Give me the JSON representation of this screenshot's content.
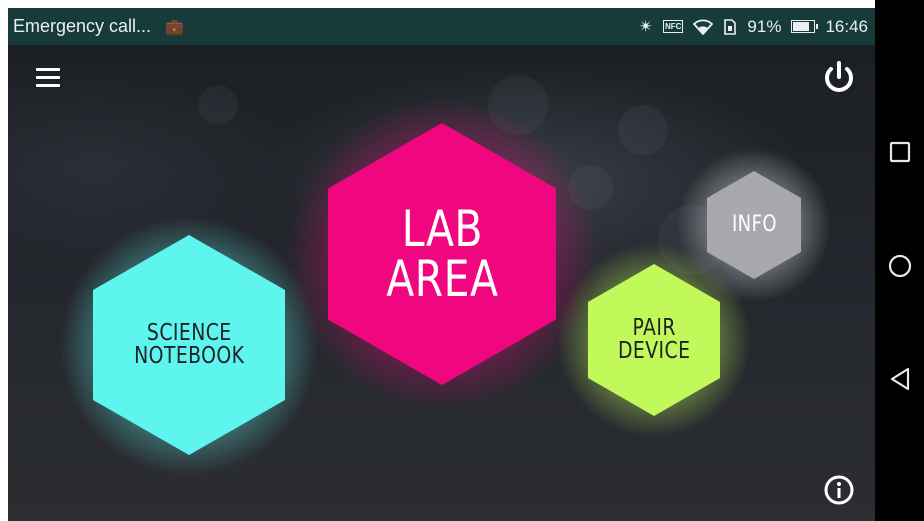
{
  "status_bar": {
    "notification": "Emergency call...",
    "bag_icon": "clipboard-check-icon",
    "bluetooth_icon": "bluetooth-icon",
    "nfc_label": "NFC",
    "wifi_icon": "wifi-icon",
    "sim_icon": "sim-icon",
    "battery": "91%",
    "battery_level": 0.91,
    "time": "16:46",
    "background": "#173b3a"
  },
  "toolbar": {
    "menu_icon": "hamburger-menu-icon",
    "power_icon": "power-icon",
    "info_icon": "info-icon"
  },
  "tiles": {
    "science": {
      "line1": "SCIENCE",
      "line2": "NOTEBOOK",
      "color": "#5ef5ef"
    },
    "lab": {
      "line1": "LAB",
      "line2": "AREA",
      "color": "#f0077f"
    },
    "pair": {
      "line1": "PAIR",
      "line2": "DEVICE",
      "color": "#c2f95a"
    },
    "info": {
      "line1": "INFO",
      "color": "#a7a9ac"
    }
  },
  "nav": {
    "recents_icon": "square-recents-icon",
    "home_icon": "circle-home-icon",
    "back_icon": "triangle-back-icon"
  }
}
